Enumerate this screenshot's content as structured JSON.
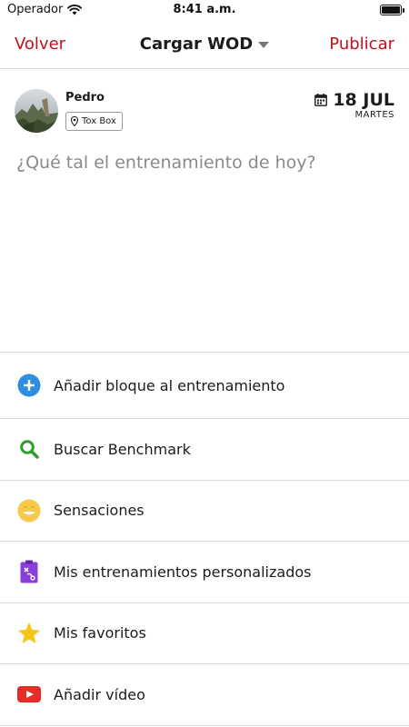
{
  "status_bar": {
    "carrier": "Operador",
    "time": "8:41 a.m.",
    "battery_level": 1.0
  },
  "nav": {
    "back_label": "Volver",
    "title": "Cargar WOD",
    "publish_label": "Publicar",
    "accent_color": "#c0111a"
  },
  "post": {
    "user_name": "Pedro",
    "box_name": "Tox Box",
    "date": "18 JUL",
    "weekday": "MARTES",
    "placeholder": "¿Qué tal el entrenamiento de hoy?"
  },
  "options": [
    {
      "label": "Añadir bloque al entrenamiento",
      "icon": "plus-circle-icon",
      "color": "#2f8de4"
    },
    {
      "label": "Buscar Benchmark",
      "icon": "search-icon",
      "color": "#2e9e2e"
    },
    {
      "label": "Sensaciones",
      "icon": "smiley-icon",
      "color": "#f7c948"
    },
    {
      "label": "Mis entrenamientos personalizados",
      "icon": "clipboard-icon",
      "color": "#8b3fd9"
    },
    {
      "label": "Mis favoritos",
      "icon": "star-icon",
      "color": "#f5c518"
    },
    {
      "label": "Añadir vídeo",
      "icon": "youtube-icon",
      "color": "#e52d27"
    }
  ]
}
